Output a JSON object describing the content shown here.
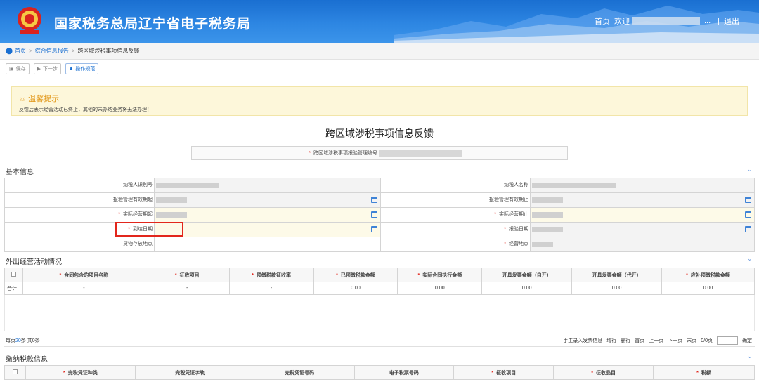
{
  "header": {
    "title": "国家税务总局辽宁省电子税务局",
    "nav_home": "首页",
    "nav_welcome": "欢迎",
    "nav_ellipsis": "...",
    "nav_sep": "|",
    "nav_logout": "退出"
  },
  "breadcrumb": {
    "items": [
      "首页",
      "综合信息报告",
      "跨区域涉税事项信息反馈"
    ],
    "sep": ">"
  },
  "toolbar": {
    "save": "保存",
    "next": "下一步",
    "guide": "操作规范"
  },
  "tip": {
    "title": "温馨提示",
    "text": "反馈后表示经营活动已终止，其他的未办结业务将无法办理！"
  },
  "page_title": "跨区域涉税事项信息反馈",
  "ref": {
    "label": "跨区域涉税事项报验管理编号"
  },
  "basic": {
    "title": "基本信息",
    "taxpayer_id": "纳税人识别号",
    "taxpayer_name": "纳税人名称",
    "valid_start": "报验管理有效期起",
    "valid_end": "报验管理有效期止",
    "actual_start": "实际经营期起",
    "actual_end": "实际经营期止",
    "arrival_date": "到达日期",
    "report_date": "报验日期",
    "goods_location": "货物存放地点",
    "business_location": "经营地点"
  },
  "activity": {
    "title": "外出经营活动情况",
    "headers": [
      "合同包含的项目名称",
      "征收项目",
      "预缴税款征收率",
      "已预缴税款金额",
      "实际合同执行金额",
      "开具发票金额（自开）",
      "开具发票金额（代开）",
      "应补预缴税款金额"
    ],
    "required": [
      true,
      true,
      true,
      true,
      true,
      false,
      false,
      true
    ],
    "total_row": [
      "合计",
      "-",
      "-",
      "-",
      "0.00",
      "0.00",
      "0.00",
      "0.00",
      "0.00"
    ]
  },
  "pager": {
    "per_page_prefix": "每页",
    "per_page": "20",
    "per_page_suffix": "条 共0条",
    "manual_invoice": "手工录入发票信息",
    "add_row": "增行",
    "del_row": "删行",
    "first": "首页",
    "prev": "上一页",
    "next": "下一页",
    "last": "末页",
    "page_info": "0/0页",
    "confirm": "确定"
  },
  "payment": {
    "title": "缴纳税款信息",
    "headers": [
      "完税凭证种类",
      "完税凭证字轨",
      "完税凭证号码",
      "电子税票号码",
      "征收项目",
      "征收品目",
      "税额"
    ],
    "required": [
      true,
      false,
      false,
      false,
      true,
      true,
      true
    ]
  },
  "colors": {
    "header_blue": "#1a6fd1",
    "required_red": "#e2261c",
    "tip_orange": "#e2991c",
    "link_blue": "#1a6fd1"
  }
}
